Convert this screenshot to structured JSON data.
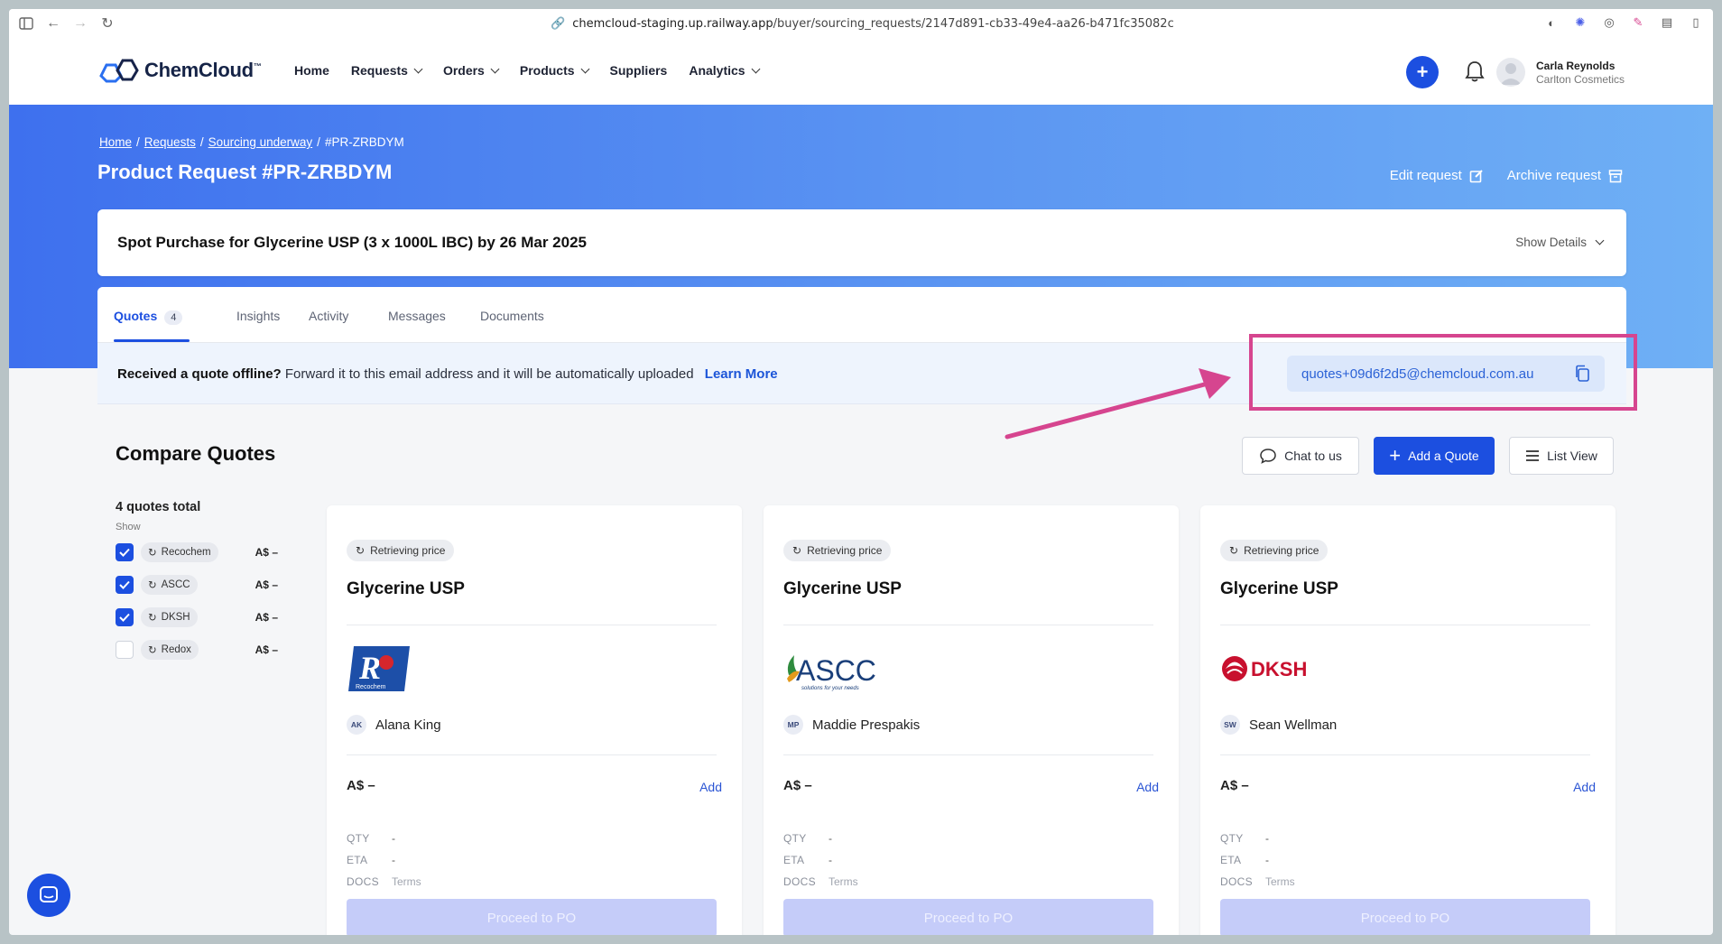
{
  "browser": {
    "url_host": "chemcloud-staging.up.railway.app",
    "url_path": "/buyer/sourcing_requests/2147d891-cb33-49e4-aa26-b471fc35082c"
  },
  "navbar": {
    "logo_text": "ChemCloud",
    "logo_tm": "™",
    "items": [
      {
        "label": "Home",
        "dropdown": false
      },
      {
        "label": "Requests",
        "dropdown": true
      },
      {
        "label": "Orders",
        "dropdown": true
      },
      {
        "label": "Products",
        "dropdown": true
      },
      {
        "label": "Suppliers",
        "dropdown": false
      },
      {
        "label": "Analytics",
        "dropdown": true
      }
    ],
    "plus_label": "+",
    "user_name": "Carla Reynolds",
    "user_org": "Carlton Cosmetics"
  },
  "breadcrumb": {
    "home": "Home",
    "sep": "/",
    "requests": "Requests",
    "sourcing": "Sourcing underway",
    "current": "#PR-ZRBDYM"
  },
  "page": {
    "title": "Product Request #PR-ZRBDYM",
    "edit_label": "Edit request",
    "archive_label": "Archive request"
  },
  "summary": {
    "title": "Spot Purchase for Glycerine USP (3 x 1000L IBC) by 26 Mar 2025",
    "show_details": "Show Details"
  },
  "tabs": [
    {
      "label": "Quotes",
      "count": "4"
    },
    {
      "label": "Insights"
    },
    {
      "label": "Activity"
    },
    {
      "label": "Messages"
    },
    {
      "label": "Documents"
    }
  ],
  "banner": {
    "bold": "Received a quote offline?",
    "text": "Forward it to this email address and it will be automatically uploaded",
    "learn_more": "Learn More",
    "email": "quotes+09d6f2d5@chemcloud.com.au"
  },
  "compare": {
    "title": "Compare Quotes",
    "chat_label": "Chat to us",
    "add_label": "Add a Quote",
    "list_label": "List View"
  },
  "filter": {
    "total": "4 quotes total",
    "show": "Show",
    "suppliers": [
      {
        "name": "Recochem",
        "price": "A$ –",
        "checked": true
      },
      {
        "name": "ASCC",
        "price": "A$ –",
        "checked": true
      },
      {
        "name": "DKSH",
        "price": "A$ –",
        "checked": true
      },
      {
        "name": "Redox",
        "price": "A$ –",
        "checked": false
      }
    ]
  },
  "cards": [
    {
      "status": "Retrieving price",
      "product": "Glycerine USP",
      "supplier": "Recochem",
      "initials": "AK",
      "contact": "Alana King",
      "price": "A$ –",
      "add": "Add",
      "qty_label": "QTY",
      "qty": "-",
      "eta_label": "ETA",
      "eta": "-",
      "docs_label": "DOCS",
      "docs": "Terms",
      "po": "Proceed to PO"
    },
    {
      "status": "Retrieving price",
      "product": "Glycerine USP",
      "supplier": "ASCC",
      "initials": "MP",
      "contact": "Maddie Prespakis",
      "price": "A$ –",
      "add": "Add",
      "qty_label": "QTY",
      "qty": "-",
      "eta_label": "ETA",
      "eta": "-",
      "docs_label": "DOCS",
      "docs": "Terms",
      "po": "Proceed to PO"
    },
    {
      "status": "Retrieving price",
      "product": "Glycerine USP",
      "supplier": "DKSH",
      "initials": "SW",
      "contact": "Sean Wellman",
      "price": "A$ –",
      "add": "Add",
      "qty_label": "QTY",
      "qty": "-",
      "eta_label": "ETA",
      "eta": "-",
      "docs_label": "DOCS",
      "docs": "Terms",
      "po": "Proceed to PO"
    }
  ],
  "logos": {
    "recochem_text": "Recochem",
    "ascc_text": "ASCC",
    "ascc_tagline": "solutions for your needs",
    "dksh_text": "DKSH"
  },
  "colors": {
    "primary": "#1c4fe0",
    "highlight": "#d6458f",
    "hero_start": "#3e70ee",
    "hero_end": "#6fb0f5"
  }
}
